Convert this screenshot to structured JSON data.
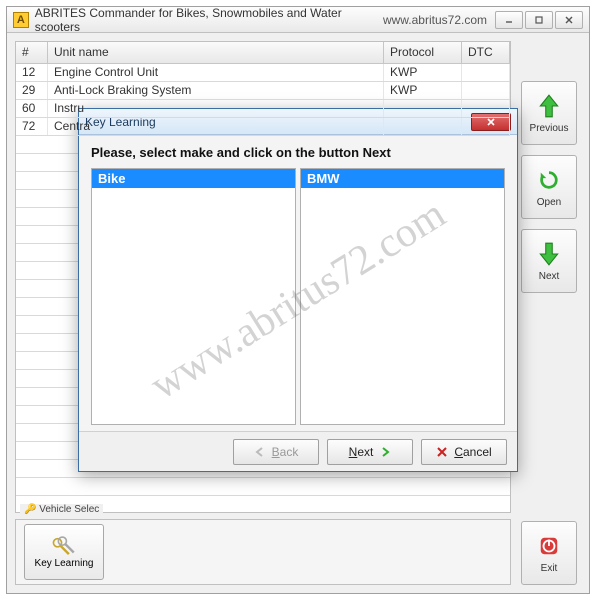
{
  "window": {
    "title": "ABRITES Commander for Bikes, Snowmobiles and Water scooters",
    "url": "www.abritus72.com",
    "app_icon_letter": "A"
  },
  "table": {
    "headers": {
      "num": "#",
      "name": "Unit name",
      "protocol": "Protocol",
      "dtc": "DTC"
    },
    "rows": [
      {
        "num": "12",
        "name": "Engine Control Unit",
        "protocol": "KWP",
        "dtc": ""
      },
      {
        "num": "29",
        "name": "Anti-Lock Braking System",
        "protocol": "KWP",
        "dtc": ""
      },
      {
        "num": "60",
        "name": "Instru",
        "protocol": "",
        "dtc": ""
      },
      {
        "num": "72",
        "name": "Centra",
        "protocol": "",
        "dtc": ""
      }
    ]
  },
  "bottom": {
    "group_label": "Vehicle Selec",
    "key_learning": "Key Learning"
  },
  "side": {
    "previous": "Previous",
    "open": "Open",
    "next": "Next",
    "exit": "Exit"
  },
  "dialog": {
    "title": "Key Learning",
    "instruction": "Please, select make and click on the button Next",
    "left_selected": "Bike",
    "right_selected": "BMW",
    "back": "Back",
    "next": "Next",
    "cancel": "Cancel"
  },
  "watermark": "www.abritus72.com"
}
